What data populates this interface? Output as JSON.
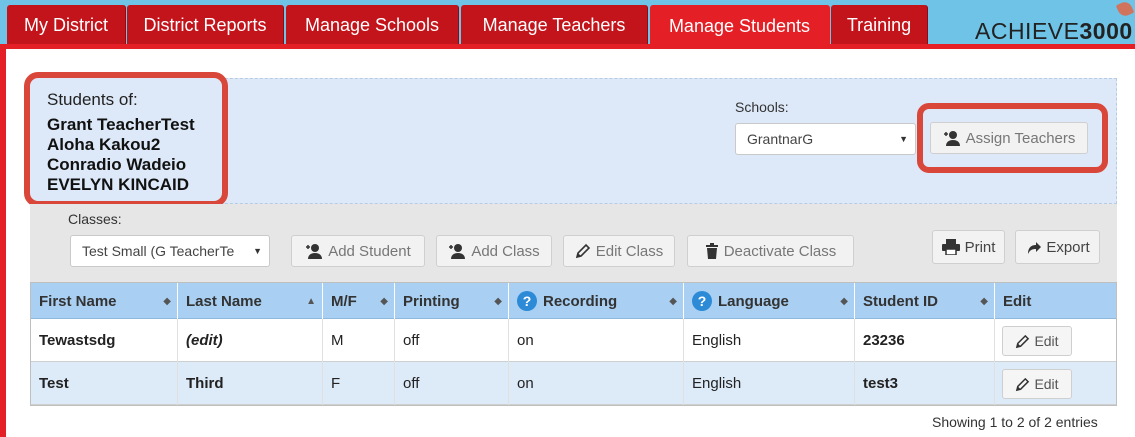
{
  "nav": {
    "tabs": [
      {
        "label": "My District"
      },
      {
        "label": "District Reports"
      },
      {
        "label": "Manage Schools"
      },
      {
        "label": "Manage Teachers"
      },
      {
        "label": "Manage Students",
        "active": true
      },
      {
        "label": "Training"
      }
    ],
    "logo_text": "ACHIEVE",
    "logo_number": "3000"
  },
  "header": {
    "students_of_label": "Students of:",
    "students": [
      "Grant TeacherTest",
      "Aloha Kakou2",
      "Conradio Wadeio",
      "EVELYN KINCAID"
    ],
    "schools_label": "Schools:",
    "school_selected": "GrantnarG",
    "assign_teachers_label": "Assign Teachers"
  },
  "toolbar": {
    "classes_label": "Classes:",
    "class_selected": "Test Small (G TeacherTe",
    "add_student_label": "Add Student",
    "add_class_label": "Add Class",
    "edit_class_label": "Edit Class",
    "deactivate_class_label": "Deactivate Class",
    "print_label": "Print",
    "export_label": "Export"
  },
  "table": {
    "columns": [
      "First Name",
      "Last Name",
      "M/F",
      "Printing",
      "Recording",
      "Language",
      "Student ID",
      "Edit"
    ],
    "rows": [
      {
        "first": "Tewastsdg",
        "last": "(edit)",
        "mf": "M",
        "printing": "off",
        "recording": "on",
        "language": "English",
        "student_id": "23236",
        "edit": "Edit"
      },
      {
        "first": "Test",
        "last": "Third",
        "mf": "F",
        "printing": "off",
        "recording": "on",
        "language": "English",
        "student_id": "test3",
        "edit": "Edit"
      }
    ],
    "footer": "Showing 1 to 2 of 2 entries"
  },
  "colors": {
    "tab_red": "#c3141b",
    "tab_active": "#e51f26",
    "highlight_outline": "#d9473a",
    "header_blue": "#a9cff2"
  }
}
